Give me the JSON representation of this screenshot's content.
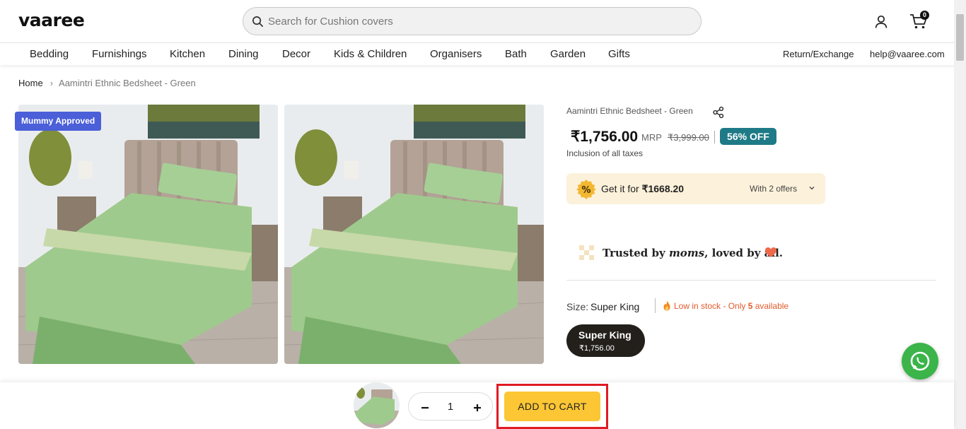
{
  "header": {
    "logo": "vaaree",
    "search_placeholder": "Search for Cushion covers",
    "cart_count": "0"
  },
  "nav": {
    "items": [
      "Bedding",
      "Furnishings",
      "Kitchen",
      "Dining",
      "Decor",
      "Kids & Children",
      "Organisers",
      "Bath",
      "Garden",
      "Gifts"
    ],
    "return_exchange": "Return/Exchange",
    "email": "help@vaaree.com"
  },
  "breadcrumb": {
    "home": "Home",
    "separator": "›",
    "current": "Aamintri Ethnic Bedsheet - Green"
  },
  "gallery": {
    "badge": "Mummy Approved"
  },
  "product": {
    "title": "Aamintri Ethnic Bedsheet - Green",
    "price": "₹1,756.00",
    "mrp_label": "MRP",
    "mrp": "₹3,999.00",
    "discount": "56% OFF",
    "tax_note": "Inclusion of all taxes",
    "offer": {
      "prefix": "Get it for ",
      "price": "₹1668.20",
      "count": "With 2 offers"
    },
    "trust": {
      "part1": "Trusted by ",
      "moms": "moms",
      "part2": ", loved by all."
    },
    "size": {
      "label": "Size:",
      "value": "Super King",
      "stock_prefix": "Low in stock - Only ",
      "stock_count": "5",
      "stock_suffix": " available"
    },
    "size_option": {
      "name": "Super King",
      "price": "₹1,756.00"
    }
  },
  "sticky_bar": {
    "quantity": "1",
    "add_to_cart": "ADD TO CART"
  },
  "colors": {
    "discount_badge": "#1d7a86",
    "add_to_cart": "#fcc634",
    "mummy_badge": "#4a5fd8",
    "stock_warning": "#e25a2b",
    "offer_bg": "#fcf1da",
    "whatsapp": "#3bb44a"
  },
  "icons": [
    "search-icon",
    "user-icon",
    "cart-icon",
    "share-icon",
    "percent-offer-icon",
    "chevron-down-icon",
    "trust-logo-icon",
    "heart-icon",
    "fire-icon",
    "whatsapp-icon",
    "minus-icon",
    "plus-icon"
  ]
}
